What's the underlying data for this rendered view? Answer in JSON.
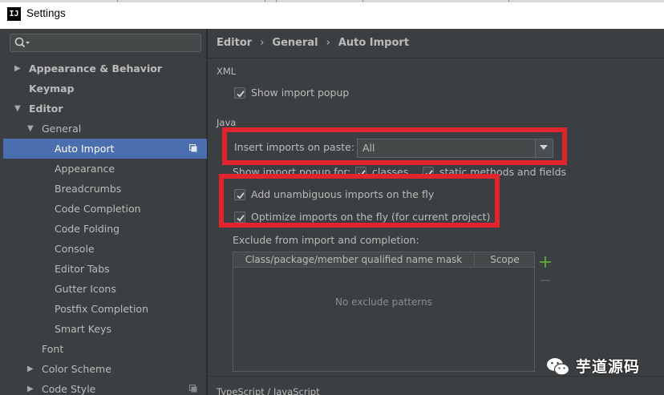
{
  "window": {
    "title": "Settings",
    "app_icon_text": "IJ"
  },
  "search": {
    "placeholder": ""
  },
  "tree": [
    {
      "label": "Appearance & Behavior",
      "level": 0,
      "arrow": "▶",
      "bold": true
    },
    {
      "label": "Keymap",
      "level": 0,
      "arrow": "",
      "bold": true
    },
    {
      "label": "Editor",
      "level": 0,
      "arrow": "▼",
      "bold": true
    },
    {
      "label": "General",
      "level": 1,
      "arrow": "▼",
      "bold": false
    },
    {
      "label": "Auto Import",
      "level": 2,
      "arrow": "",
      "bold": false,
      "selected": true,
      "copy_icon": true
    },
    {
      "label": "Appearance",
      "level": 2,
      "arrow": "",
      "bold": false
    },
    {
      "label": "Breadcrumbs",
      "level": 2,
      "arrow": "",
      "bold": false
    },
    {
      "label": "Code Completion",
      "level": 2,
      "arrow": "",
      "bold": false
    },
    {
      "label": "Code Folding",
      "level": 2,
      "arrow": "",
      "bold": false
    },
    {
      "label": "Console",
      "level": 2,
      "arrow": "",
      "bold": false
    },
    {
      "label": "Editor Tabs",
      "level": 2,
      "arrow": "",
      "bold": false
    },
    {
      "label": "Gutter Icons",
      "level": 2,
      "arrow": "",
      "bold": false
    },
    {
      "label": "Postfix Completion",
      "level": 2,
      "arrow": "",
      "bold": false
    },
    {
      "label": "Smart Keys",
      "level": 2,
      "arrow": "",
      "bold": false
    },
    {
      "label": "Font",
      "level": 1,
      "arrow": "",
      "bold": false
    },
    {
      "label": "Color Scheme",
      "level": 1,
      "arrow": "▶",
      "bold": false
    },
    {
      "label": "Code Style",
      "level": 1,
      "arrow": "▶",
      "bold": false,
      "copy_icon": true
    }
  ],
  "breadcrumb": {
    "items": [
      "Editor",
      "General",
      "Auto Import"
    ],
    "separator": "›"
  },
  "xml": {
    "section_label": "XML",
    "show_import_popup": {
      "label": "Show import popup",
      "checked": true
    }
  },
  "java": {
    "section_label": "Java",
    "insert_imports_label": "Insert imports on paste:",
    "insert_imports_value": "All",
    "show_popup_for_label": "Show import popup for:",
    "classes": {
      "label": "classes",
      "checked": true
    },
    "static_methods": {
      "label": "static methods and fields",
      "checked": true
    },
    "add_unambiguous": {
      "label": "Add unambiguous imports on the fly",
      "checked": true
    },
    "optimize_imports": {
      "label": "Optimize imports on the fly (for current project)",
      "checked": true
    },
    "exclude_label": "Exclude from import and completion:",
    "table": {
      "columns": [
        "Class/package/member qualified name mask",
        "Scope"
      ],
      "empty_text": "No exclude patterns"
    }
  },
  "typescript": {
    "section_label": "TypeScript / JavaScript"
  },
  "watermark": {
    "text": "芋道源码"
  },
  "colors": {
    "selection": "#4b6eaf",
    "annotation_red": "#e1242d",
    "add_green": "#5aa13c"
  }
}
